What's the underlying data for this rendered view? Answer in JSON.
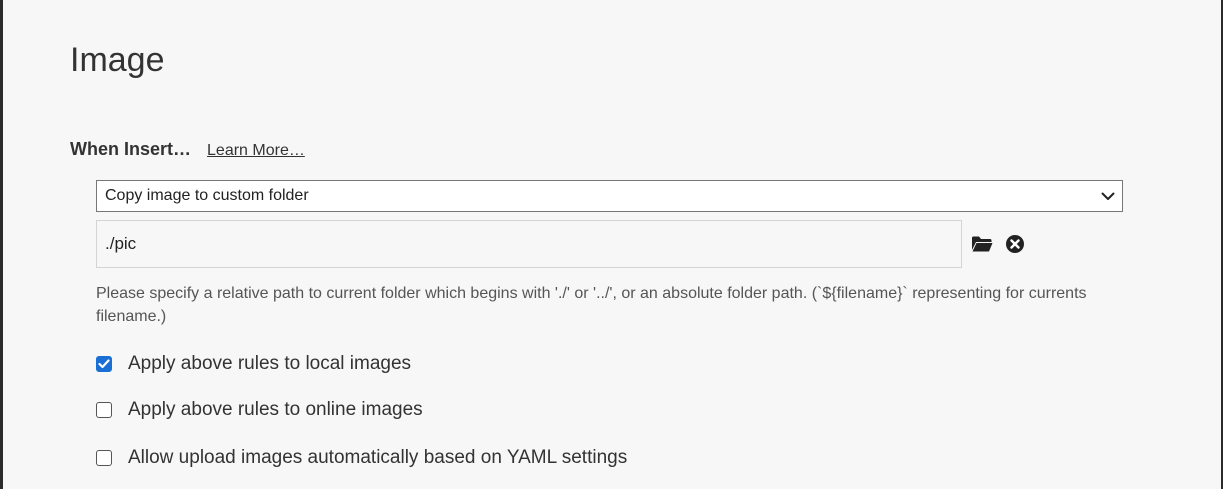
{
  "page": {
    "title": "Image"
  },
  "when_insert": {
    "label": "When Insert…",
    "learn_more": "Learn More…",
    "select": {
      "selected": "Copy image to custom folder"
    },
    "path_input": {
      "value": "./pic"
    },
    "hint": " Please specify a relative path to current folder which begins with './' or '../', or an absolute folder path. (`${filename}` representing for currents filename.)"
  },
  "options": [
    {
      "label": "Apply above rules to local images",
      "checked": true
    },
    {
      "label": "Apply above rules to online images",
      "checked": false
    },
    {
      "label": "Allow upload images automatically based on YAML settings",
      "checked": false
    }
  ],
  "icons": {
    "folder": "folder-icon",
    "clear": "clear-circle-icon",
    "chevron": "chevron-down-icon",
    "check": "checkmark-icon"
  },
  "colors": {
    "checkbox_checked": "#1a6fd4",
    "background": "#f7f7f7"
  }
}
